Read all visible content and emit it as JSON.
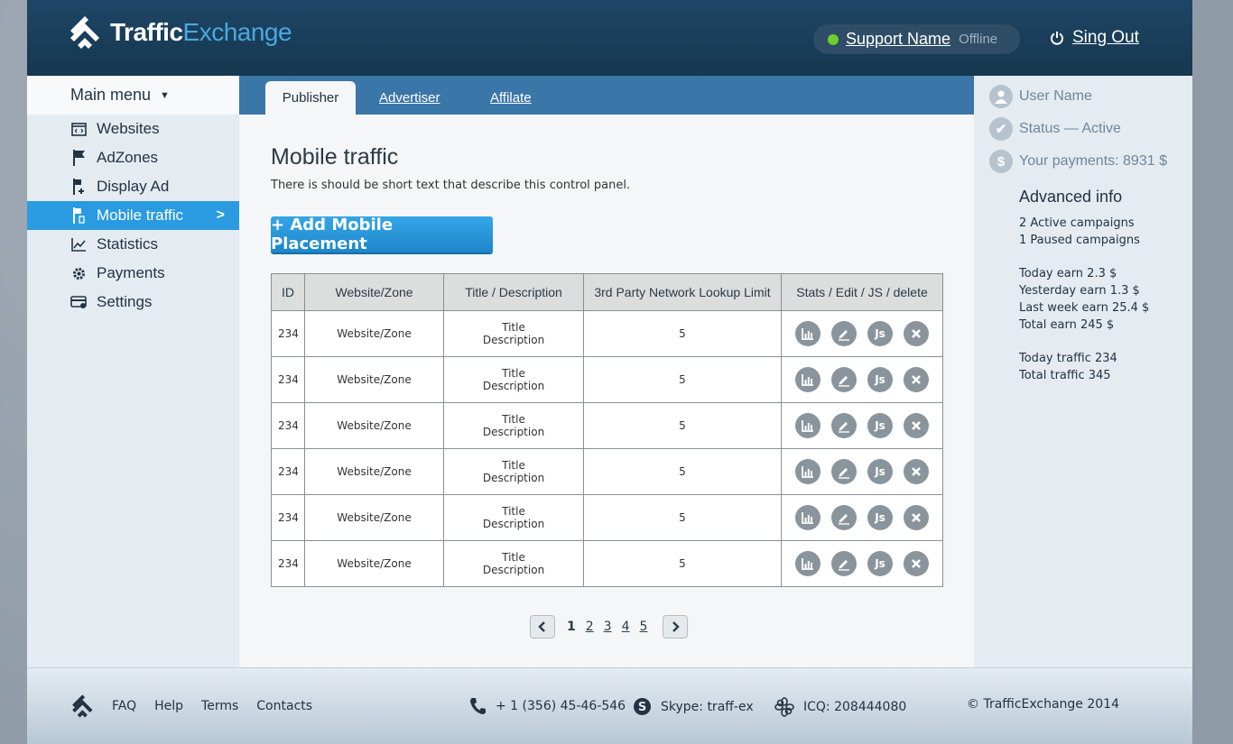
{
  "brand": {
    "name_bold": "Traffic",
    "name_light": "Exchange"
  },
  "header": {
    "support_name": "Support Name",
    "support_status": "Offline",
    "signout_label": "Sing Out"
  },
  "sidebar": {
    "title": "Main menu",
    "items": [
      {
        "label": "Websites",
        "icon": "code-window-icon"
      },
      {
        "label": "AdZones",
        "icon": "flag-icon"
      },
      {
        "label": "Display Ad",
        "icon": "flag-plus-icon"
      },
      {
        "label": "Mobile traffic",
        "icon": "flag-mobile-icon",
        "active": true
      },
      {
        "label": "Statistics",
        "icon": "chart-line-icon"
      },
      {
        "label": "Payments",
        "icon": "gear-icon"
      },
      {
        "label": "Settings",
        "icon": "card-icon"
      }
    ]
  },
  "tabs": [
    {
      "label": "Publisher",
      "active": true
    },
    {
      "label": "Advertiser"
    },
    {
      "label": "Affilate"
    }
  ],
  "main": {
    "title": "Mobile traffic",
    "description": "There is should be short text that describe this control panel.",
    "add_button": "+ Add Mobile Placement",
    "columns": [
      "ID",
      "Website/Zone",
      "Title / Description",
      "3rd Party Network Lookup Limit",
      "Stats / Edit / JS / delete"
    ],
    "rows": [
      {
        "id": "234",
        "zone": "Website/Zone",
        "title": "Title",
        "desc": "Description",
        "limit": "5"
      },
      {
        "id": "234",
        "zone": "Website/Zone",
        "title": "Title",
        "desc": "Description",
        "limit": "5"
      },
      {
        "id": "234",
        "zone": "Website/Zone",
        "title": "Title",
        "desc": "Description",
        "limit": "5"
      },
      {
        "id": "234",
        "zone": "Website/Zone",
        "title": "Title",
        "desc": "Description",
        "limit": "5"
      },
      {
        "id": "234",
        "zone": "Website/Zone",
        "title": "Title",
        "desc": "Description",
        "limit": "5"
      },
      {
        "id": "234",
        "zone": "Website/Zone",
        "title": "Title",
        "desc": "Description",
        "limit": "5"
      }
    ],
    "pagination": {
      "pages": [
        "1",
        "2",
        "3",
        "4",
        "5"
      ],
      "current": "1"
    }
  },
  "right_panel": {
    "user_name": "User Name",
    "status": "Status — Active",
    "payments": "Your payments: 8931 $",
    "advanced_title": "Advanced info",
    "campaigns": [
      "2 Active campaigns",
      "1 Paused campaigns"
    ],
    "earnings": [
      "Today earn 2.3 $",
      "Yesterday earn 1.3 $",
      "Last week earn 25.4 $",
      "Total earn 245 $"
    ],
    "traffic": [
      "Today traffic 234",
      "Total traffic 345"
    ]
  },
  "footer": {
    "links": [
      "FAQ",
      "Help",
      "Terms",
      "Contacts"
    ],
    "phone": "+ 1 (356) 45-46-546",
    "skype": "Skype: traff-ex",
    "icq": "ICQ: 208444080",
    "copyright": "© TrafficExchange 2014"
  },
  "colors": {
    "accent": "#2a9be0",
    "header": "#1e4666",
    "tabbar": "#3a76a8",
    "online": "#6fce2e"
  }
}
